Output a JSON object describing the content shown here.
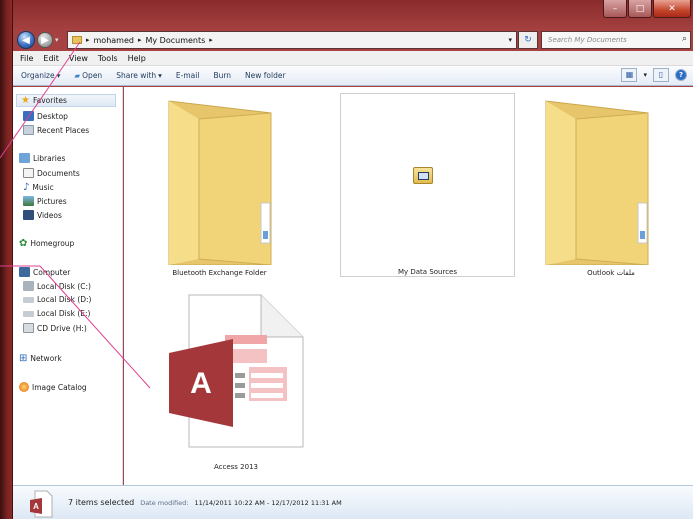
{
  "window": {
    "caption_min": "–",
    "caption_max": "□",
    "caption_close": "✕"
  },
  "address": {
    "crumbs": [
      "mohamed",
      "My Documents"
    ],
    "search_placeholder": "Search My Documents"
  },
  "menu": [
    "File",
    "Edit",
    "View",
    "Tools",
    "Help"
  ],
  "toolbar": {
    "organize": "Organize",
    "open": "Open",
    "share_with": "Share with",
    "email": "E-mail",
    "burn": "Burn",
    "new_folder": "New folder"
  },
  "nav": {
    "favorites": "Favorites",
    "desktop": "Desktop",
    "recent_places": "Recent Places",
    "libraries": "Libraries",
    "documents": "Documents",
    "music": "Music",
    "pictures": "Pictures",
    "videos": "Videos",
    "homegroup": "Homegroup",
    "computer": "Computer",
    "disk_c": "Local Disk (C:)",
    "disk_d": "Local Disk (D:)",
    "disk_e": "Local Disk (E:)",
    "cd_drive": "CD Drive (H:)",
    "network": "Network",
    "image_catalog": "Image Catalog"
  },
  "items": {
    "bluetooth": "Bluetooth Exchange Folder",
    "data_sources": "My Data Sources",
    "outlook": "ملفات Outlook",
    "access": "Access 2013"
  },
  "status": {
    "count": "7 items selected",
    "date_label": "Date modified:",
    "date_value": "11/14/2011 10:22 AM - 12/17/2012 11:31 AM"
  },
  "colors": {
    "frame": "#a74242",
    "access_red": "#a4373a",
    "folder_yellow": "#f2d478"
  }
}
